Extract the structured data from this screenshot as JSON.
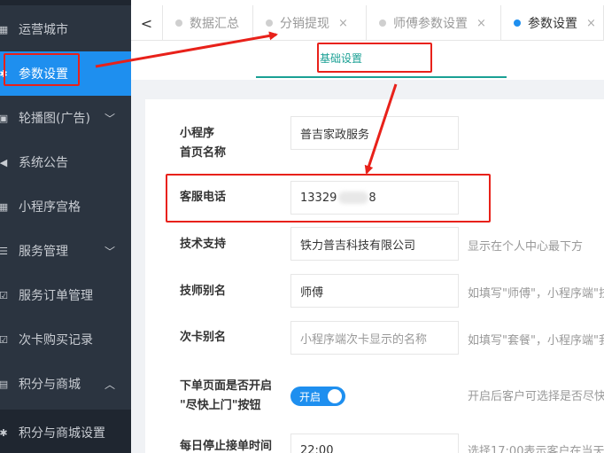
{
  "sidebar": {
    "items": [
      {
        "label": "运营城市",
        "icon": "building-icon",
        "glyph": "▦",
        "has_chevron": false,
        "chevron": ""
      },
      {
        "label": "参数设置",
        "icon": "gear-icon",
        "glyph": "✱",
        "has_chevron": false,
        "chevron": ""
      },
      {
        "label": "轮播图(广告)",
        "icon": "image-icon",
        "glyph": "▣",
        "has_chevron": true,
        "chevron": "﹀"
      },
      {
        "label": "系统公告",
        "icon": "speaker-icon",
        "glyph": "◀",
        "has_chevron": false,
        "chevron": ""
      },
      {
        "label": "小程序宫格",
        "icon": "grid-icon",
        "glyph": "▦",
        "has_chevron": false,
        "chevron": ""
      },
      {
        "label": "服务管理",
        "icon": "list-icon",
        "glyph": "☰",
        "has_chevron": true,
        "chevron": "﹀"
      },
      {
        "label": "服务订单管理",
        "icon": "checkbox-icon",
        "glyph": "☑",
        "has_chevron": false,
        "chevron": ""
      },
      {
        "label": "次卡购买记录",
        "icon": "checkbox-icon",
        "glyph": "☑",
        "has_chevron": false,
        "chevron": ""
      },
      {
        "label": "积分与商城",
        "icon": "cart-icon",
        "glyph": "▤",
        "has_chevron": true,
        "chevron": "︿"
      },
      {
        "label": "积分与商城设置",
        "icon": "gear-icon",
        "glyph": "✱",
        "has_chevron": false,
        "chevron": ""
      }
    ]
  },
  "tabs": {
    "back_glyph": "<",
    "items": [
      {
        "label": "数据汇总",
        "close": ""
      },
      {
        "label": "分销提现",
        "close": "×"
      },
      {
        "label": "师傅参数设置",
        "close": "×"
      },
      {
        "label": "参数设置",
        "close": "×"
      }
    ]
  },
  "subtab": {
    "label": "基础设置"
  },
  "form": {
    "fields": [
      {
        "label_line1": "小程序",
        "label_line2": "首页名称",
        "value": "普吉家政服务",
        "placeholder": "",
        "hint": ""
      },
      {
        "label": "客服电话",
        "value": "13329",
        "value_suffix": "8"
      },
      {
        "label": "技术支持",
        "value": "铁力普吉科技有限公司",
        "hint": "显示在个人中心最下方"
      },
      {
        "label": "技师别名",
        "value": "师傅",
        "hint": "如填写\"师傅\"，小程序端\"技"
      },
      {
        "label": "次卡别名",
        "placeholder": "小程序端次卡显示的名称",
        "hint": "如填写\"套餐\"，小程序端\"我"
      },
      {
        "label_line1": "下单页面是否开启",
        "label_line2": "\"尽快上门\"按钮",
        "switch_text": "开启",
        "hint": "开启后客户可选择是否尽快"
      },
      {
        "label": "每日停止接单时间",
        "value": "22:00",
        "hint": "选择17:00表示客户在当天1"
      }
    ]
  },
  "colors": {
    "sidebar_bg": "#2b3440",
    "accent": "#1e8fef",
    "teal": "#1aa094",
    "annotation_red": "#e8211a"
  }
}
